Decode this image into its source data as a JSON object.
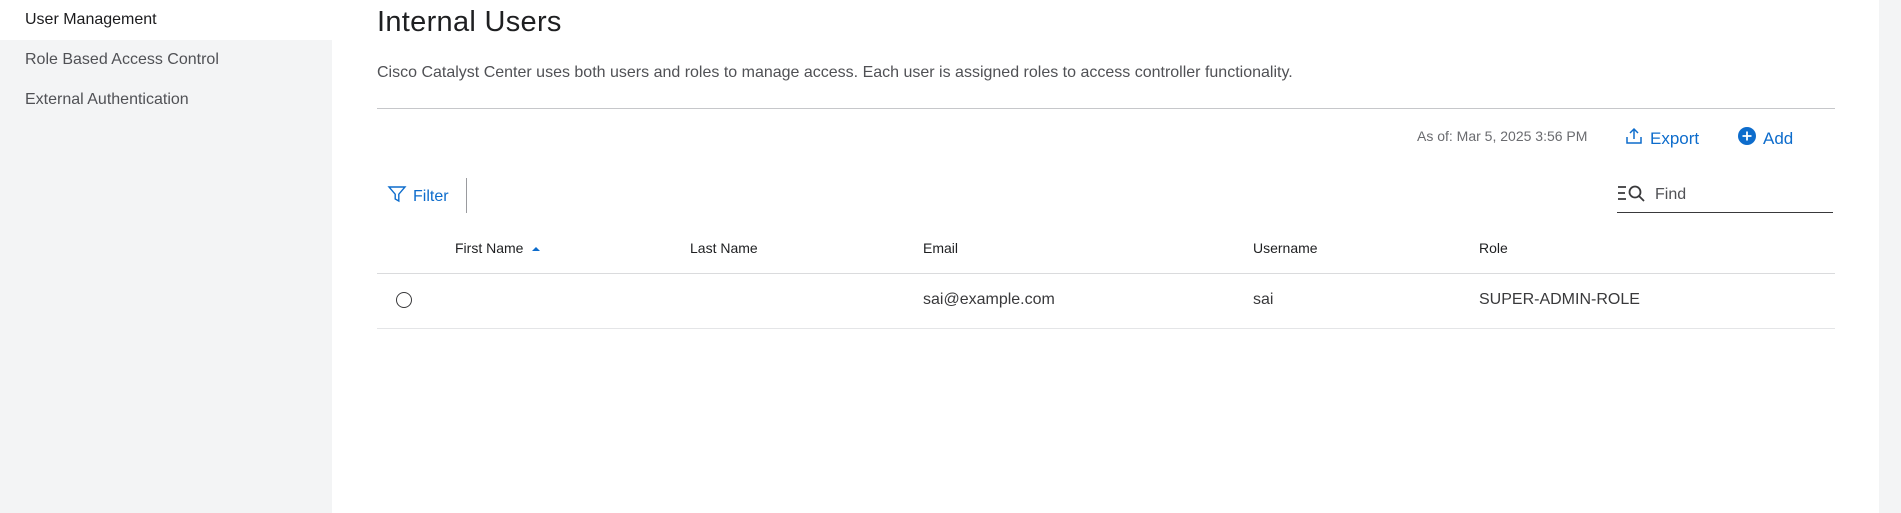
{
  "sidebar": {
    "items": [
      {
        "label": "User Management",
        "active": true
      },
      {
        "label": "Role Based Access Control",
        "active": false
      },
      {
        "label": "External Authentication",
        "active": false
      }
    ]
  },
  "page": {
    "title": "Internal Users",
    "description": "Cisco Catalyst Center uses both users and roles to manage access. Each user is assigned roles to access controller functionality."
  },
  "toolbar": {
    "as_of": "As of: Mar 5, 2025 3:56 PM",
    "export_label": "Export",
    "add_label": "Add",
    "filter_label": "Filter",
    "find_placeholder": "Find",
    "find_value": ""
  },
  "table": {
    "columns": [
      "First Name",
      "Last Name",
      "Email",
      "Username",
      "Role"
    ],
    "sort": {
      "column": "First Name",
      "direction": "ascending"
    },
    "rows": [
      {
        "first_name": "",
        "last_name": "",
        "email": "sai@example.com",
        "username": "sai",
        "role": "SUPER-ADMIN-ROLE",
        "selected": false
      }
    ]
  },
  "colors": {
    "accent": "#0d6ccc",
    "sidebar_bg": "#f3f4f5",
    "text": "#39393b"
  },
  "icons": {
    "export": "upload-icon",
    "add": "plus-circle-icon",
    "filter": "funnel-icon",
    "find": "list-search-icon",
    "sort": "caret-up-icon"
  }
}
